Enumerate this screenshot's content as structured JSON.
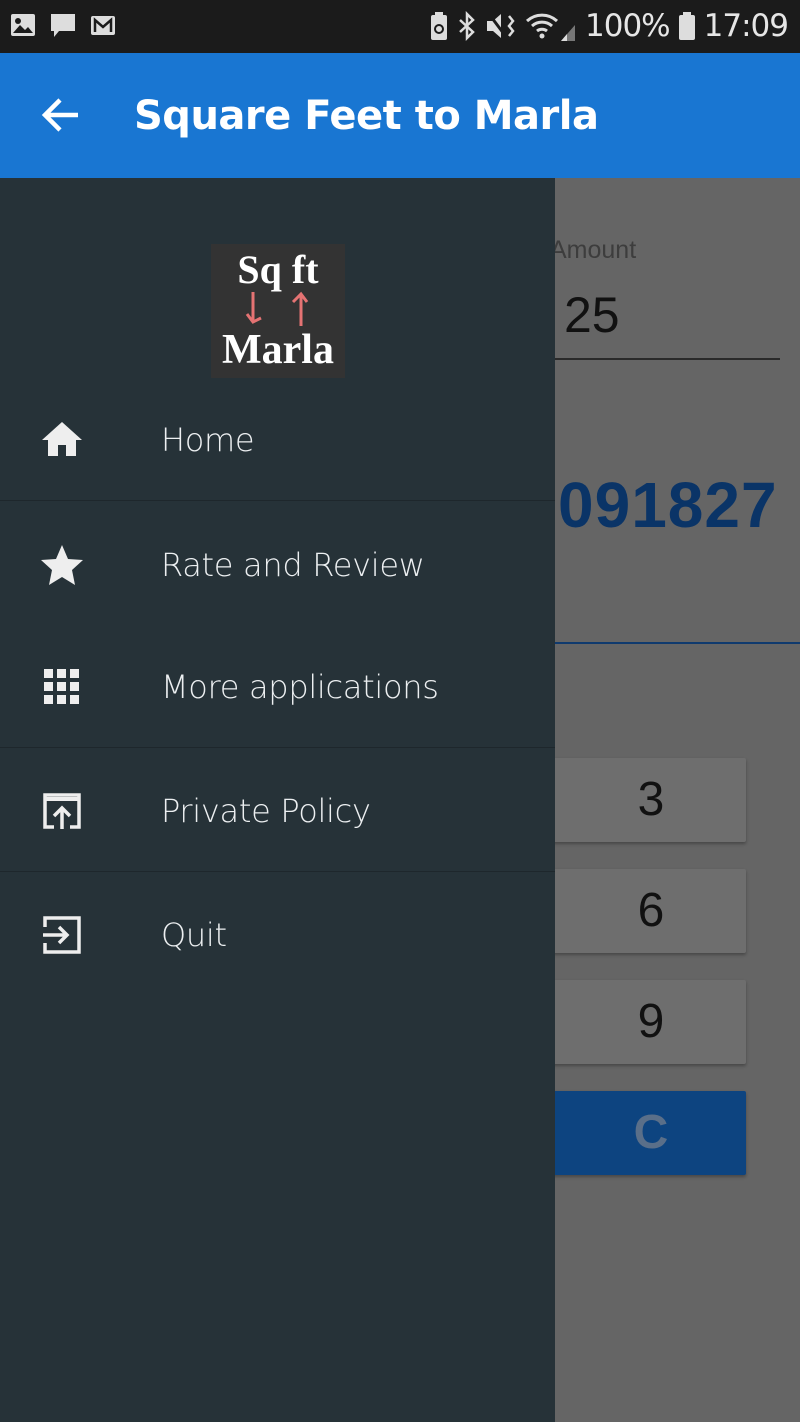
{
  "status_bar": {
    "left_icons": [
      "image-icon",
      "message-icon",
      "gmail-icon"
    ],
    "right_icons": [
      "battery-saver-icon",
      "bluetooth-icon",
      "mute-vibrate-icon",
      "wifi-icon",
      "signal-icon",
      "battery-icon"
    ],
    "battery": "100%",
    "time": "17:09"
  },
  "app_bar": {
    "title": "Square Feet to Marla",
    "back_icon": "arrow-left-icon",
    "color": "#1976d2"
  },
  "drawer": {
    "logo": {
      "line1": "Sq ft",
      "line2": "Marla"
    },
    "items": [
      {
        "label": "Home",
        "icon": "home-icon"
      },
      {
        "label": "Rate and Review",
        "icon": "star-icon"
      },
      {
        "label": "More applications",
        "icon": "apps-grid-icon"
      },
      {
        "label": "Private Policy",
        "icon": "open-in-browser-icon"
      },
      {
        "label": "Quit",
        "icon": "exit-icon"
      }
    ],
    "background": "#263238"
  },
  "main": {
    "amount_label": "Amount",
    "amount_value": "25",
    "result": "091827",
    "keys": [
      "3",
      "6",
      "9",
      "C"
    ]
  }
}
